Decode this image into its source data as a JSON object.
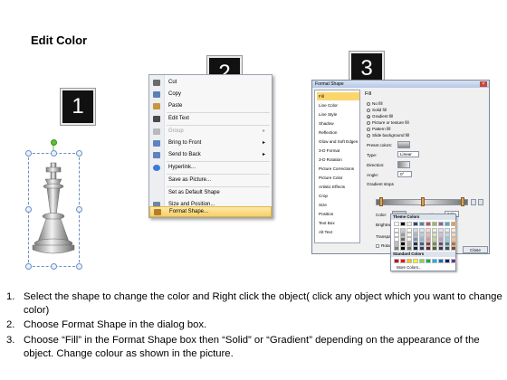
{
  "title": "Edit Color",
  "badges": [
    "1",
    "2",
    "3"
  ],
  "context_menu": {
    "items": [
      {
        "label": "Cut",
        "icon": "scissors-icon",
        "color": "#6b6b6b",
        "disabled": false,
        "submenu": false
      },
      {
        "label": "Copy",
        "icon": "copy-icon",
        "color": "#5b7fb5",
        "disabled": false,
        "submenu": false
      },
      {
        "label": "Paste",
        "icon": "paste-icon",
        "color": "#c8963e",
        "disabled": false,
        "submenu": false
      },
      {
        "label": "Edit Text",
        "icon": "edit-text-icon",
        "color": "#4a4a4a",
        "disabled": false,
        "submenu": false
      },
      {
        "label": "Group",
        "icon": "group-icon",
        "color": "#b9b9b9",
        "disabled": true,
        "submenu": true
      },
      {
        "label": "Bring to Front",
        "icon": "bring-to-front-icon",
        "color": "#5e83bd",
        "disabled": false,
        "submenu": true
      },
      {
        "label": "Send to Back",
        "icon": "send-to-back-icon",
        "color": "#5e83bd",
        "disabled": false,
        "submenu": true
      },
      {
        "label": "Hyperlink...",
        "icon": "hyperlink-icon",
        "color": "#3b7bd6",
        "disabled": false,
        "submenu": false
      },
      {
        "label": "Save as Picture...",
        "icon": "",
        "color": "",
        "disabled": false,
        "submenu": false
      },
      {
        "label": "Set as Default Shape",
        "icon": "",
        "color": "",
        "disabled": false,
        "submenu": false
      },
      {
        "label": "Size and Position...",
        "icon": "size-position-icon",
        "color": "#6f86a6",
        "disabled": false,
        "submenu": false
      },
      {
        "label": "Format Shape...",
        "icon": "format-shape-icon",
        "color": "#b57d2b",
        "disabled": false,
        "submenu": false,
        "highlighted": true
      }
    ]
  },
  "dialog": {
    "title": "Format Shape",
    "categories": [
      "Fill",
      "Line Color",
      "Line Style",
      "Shadow",
      "Reflection",
      "Glow and Soft Edges",
      "3-D Format",
      "3-D Rotation",
      "Picture Corrections",
      "Picture Color",
      "Artistic Effects",
      "Crop",
      "Size",
      "Position",
      "Text Box",
      "Alt Text"
    ],
    "selected_category": "Fill",
    "section_title": "Fill",
    "options": [
      "No fill",
      "Solid fill",
      "Gradient fill",
      "Picture or texture fill",
      "Pattern fill",
      "Slide background fill"
    ],
    "selected_option": "Gradient fill",
    "preset_label": "Preset colors:",
    "type_label": "Type:",
    "type_value": "Linear",
    "direction_label": "Direction:",
    "angle_label": "Angle:",
    "angle_value": "0°",
    "gradient_stops_label": "Gradient stops",
    "color_label": "Color:",
    "position_label": "Position:",
    "position_value": "64%",
    "brightness_label": "Brightness:",
    "transparency_label": "Transparency:",
    "rotate_label": "Rotate with shape",
    "close_label": "Close"
  },
  "palette": {
    "theme_title": "Theme Colors",
    "standard_title": "Standard Colors",
    "more_label": "More Colors...",
    "theme_colors": [
      "#ffffff",
      "#000000",
      "#eeece1",
      "#1f497d",
      "#4f81bd",
      "#c0504d",
      "#9bbb59",
      "#8064a2",
      "#4bacc6",
      "#f79646"
    ],
    "standard_colors": [
      "#c00000",
      "#ff0000",
      "#ffc000",
      "#ffff00",
      "#92d050",
      "#00b050",
      "#00b0f0",
      "#0070c0",
      "#002060",
      "#7030a0"
    ]
  },
  "steps": [
    {
      "num": "1.",
      "text": "Select the shape to change the color and Right click the object( click any object which you want to change color)"
    },
    {
      "num": "2.",
      "text": "Choose Format Shape in the dialog box."
    },
    {
      "num": "3.",
      "text": "Choose “Fill” in the Format Shape box then “Solid” or “Gradient” depending on the appearance of the object. Change colour as shown in the picture."
    }
  ]
}
